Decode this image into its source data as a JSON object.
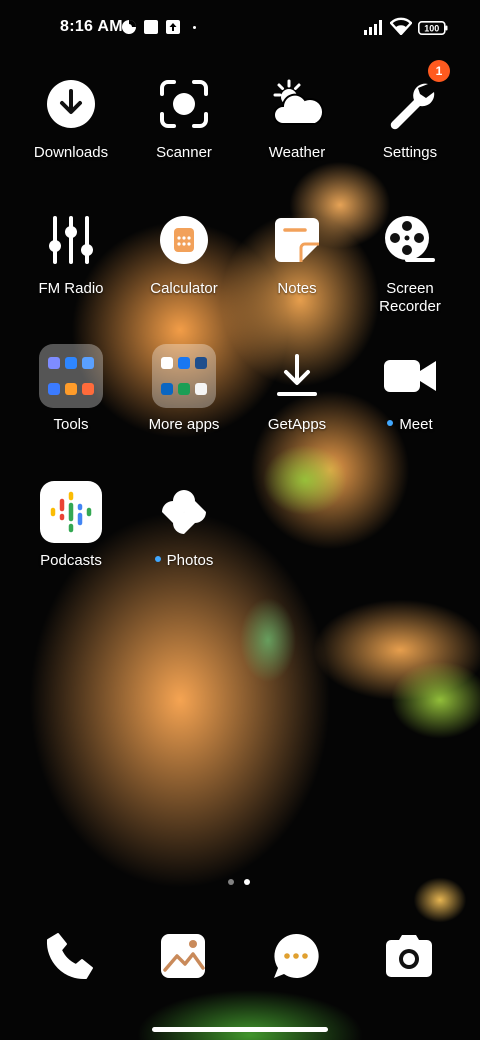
{
  "status_bar": {
    "time": "8:16 AM",
    "battery": "100",
    "icons": [
      "data-saver-icon",
      "square-notification-icon",
      "upload-notification-icon",
      "dot-icon",
      "signal-icon",
      "wifi-icon",
      "battery-icon"
    ]
  },
  "apps": {
    "downloads": {
      "label": "Downloads",
      "icon": "download-icon"
    },
    "scanner": {
      "label": "Scanner",
      "icon": "scanner-icon"
    },
    "weather": {
      "label": "Weather",
      "icon": "weather-icon"
    },
    "settings": {
      "label": "Settings",
      "icon": "wrench-icon",
      "badge": "1"
    },
    "fm_radio": {
      "label": "FM Radio",
      "icon": "sliders-icon"
    },
    "calculator": {
      "label": "Calculator",
      "icon": "calculator-icon"
    },
    "notes": {
      "label": "Notes",
      "icon": "notes-icon"
    },
    "screen_recorder": {
      "label_line1": "Screen",
      "label_line2": "Recorder",
      "icon": "film-reel-icon"
    },
    "tools": {
      "label": "Tools",
      "icon": "folder-icon"
    },
    "more_apps": {
      "label": "More apps",
      "icon": "folder-icon"
    },
    "getapps": {
      "label": "GetApps",
      "icon": "download-tray-icon"
    },
    "meet": {
      "label": "Meet",
      "icon": "video-camera-icon",
      "new": true
    },
    "podcasts": {
      "label": "Podcasts",
      "icon": "podcasts-icon"
    },
    "photos": {
      "label": "Photos",
      "icon": "pinwheel-icon",
      "new": true
    }
  },
  "pager": {
    "pages": 2,
    "current": 2
  },
  "dock": [
    {
      "name": "phone",
      "icon": "phone-icon"
    },
    {
      "name": "gallery",
      "icon": "gallery-icon"
    },
    {
      "name": "messages",
      "icon": "chat-icon"
    },
    {
      "name": "camera",
      "icon": "camera-icon"
    }
  ],
  "colors": {
    "badge": "#ff5a1f",
    "new_dot": "#41a8ff",
    "icon": "#ffffff"
  }
}
